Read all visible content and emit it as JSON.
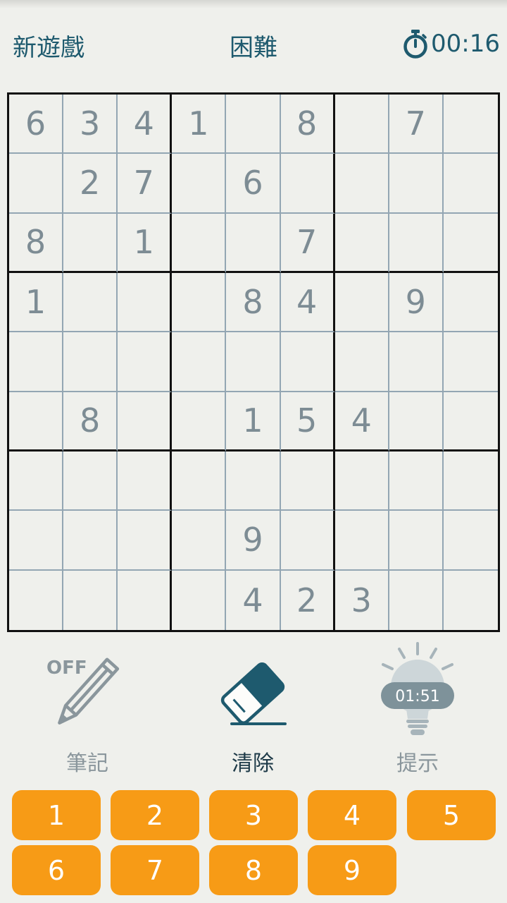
{
  "header": {
    "new_game": "新遊戲",
    "difficulty": "困難",
    "timer": "00:16"
  },
  "board": {
    "cells": [
      [
        "6",
        "3",
        "4",
        "1",
        "",
        "8",
        "",
        "7",
        ""
      ],
      [
        "",
        "2",
        "7",
        "",
        "6",
        "",
        "",
        "",
        ""
      ],
      [
        "8",
        "",
        "1",
        "",
        "",
        "7",
        "",
        "",
        ""
      ],
      [
        "1",
        "",
        "",
        "",
        "8",
        "4",
        "",
        "9",
        ""
      ],
      [
        "",
        "",
        "",
        "",
        "",
        "",
        "",
        "",
        ""
      ],
      [
        "",
        "8",
        "",
        "",
        "1",
        "5",
        "4",
        "",
        ""
      ],
      [
        "",
        "",
        "",
        "",
        "",
        "",
        "",
        "",
        ""
      ],
      [
        "",
        "",
        "",
        "",
        "9",
        "",
        "",
        "",
        ""
      ],
      [
        "",
        "",
        "",
        "",
        "4",
        "2",
        "3",
        "",
        ""
      ]
    ]
  },
  "tools": {
    "notes": {
      "label": "筆記",
      "state": "OFF"
    },
    "erase": {
      "label": "清除"
    },
    "hint": {
      "label": "提示",
      "countdown": "01:51"
    }
  },
  "numpad": [
    "1",
    "2",
    "3",
    "4",
    "5",
    "6",
    "7",
    "8",
    "9"
  ],
  "colors": {
    "background": "#eff0ec",
    "accent_dark": "#1e5a6e",
    "given_digit": "#7d8c94",
    "numpad_orange": "#f79b16"
  }
}
